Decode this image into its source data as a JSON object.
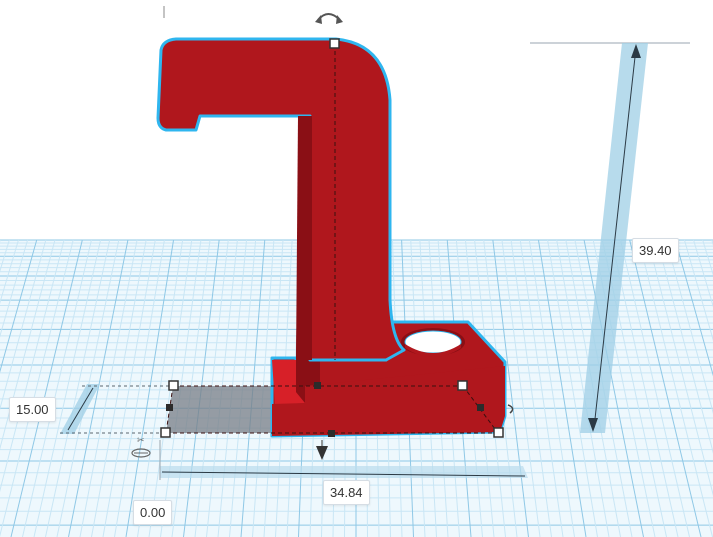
{
  "dimensions": {
    "height": "39.40",
    "width": "34.84",
    "depth": "15.00",
    "elevation": "0.00"
  },
  "colors": {
    "grid_major": "#8fc8e6",
    "grid_minor": "#c9e6f5",
    "shape_fill": "#b0171d",
    "shape_dark": "#8a0f15",
    "shape_outline": "#2fb6ef",
    "dimension_band": "#9fcfe6",
    "selection_shadow": "#777d86"
  },
  "icons": {
    "rotate": "rotate-arrow-icon",
    "move_down": "drop-arrow-icon",
    "ruler": "ruler-icon",
    "corner": "corner-handle-icon"
  }
}
